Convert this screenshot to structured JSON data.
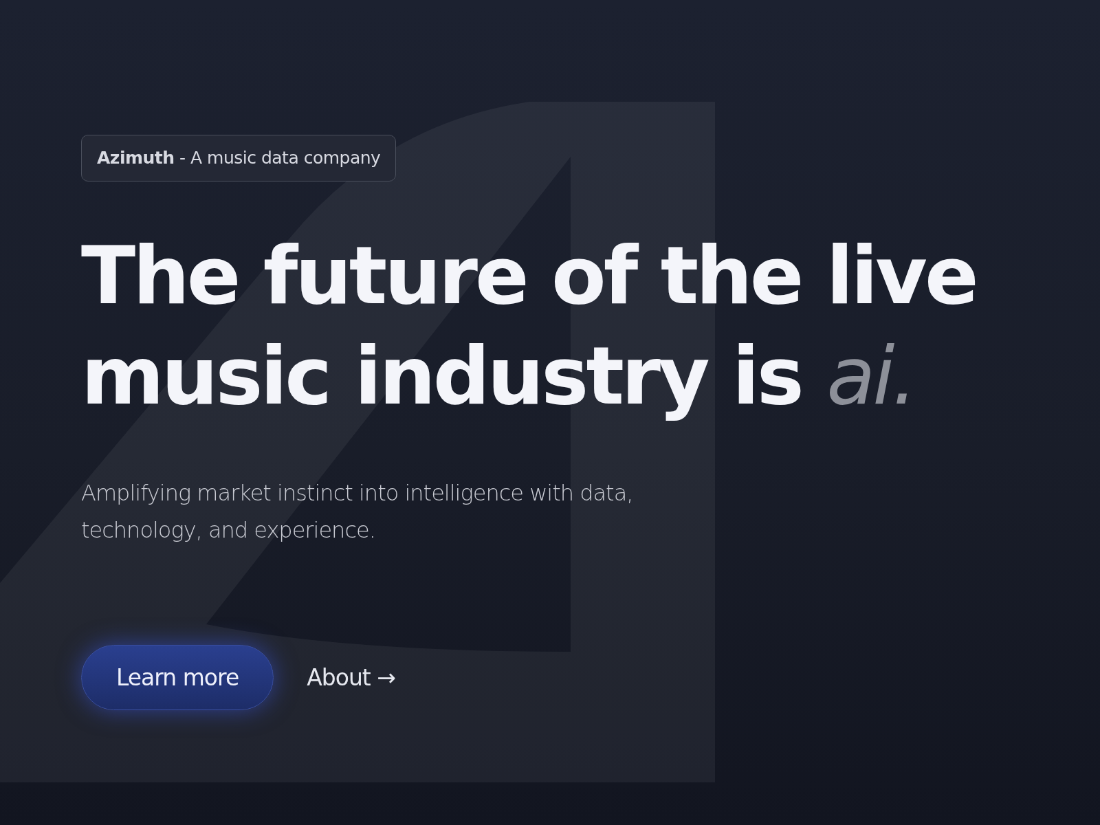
{
  "badge": {
    "text": "**Azimuth** - A music data company"
  },
  "headline": "The future of the live music industry is *ai.*",
  "subtitle": "Amplifying market instinct into intelligence with data, technology, and experience.",
  "actions": [
    {
      "kind": "primary",
      "label": "Learn more"
    },
    {
      "kind": "link",
      "label": "About →"
    }
  ]
}
